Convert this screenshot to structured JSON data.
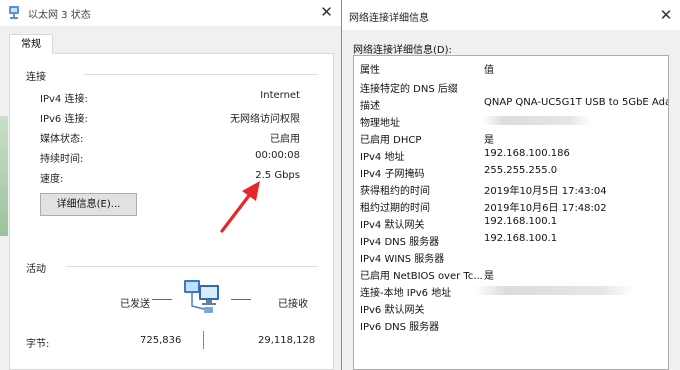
{
  "status_window": {
    "title": "以太网 3 状态",
    "close": "✕",
    "tab_general": "常规",
    "connection_group": "连接",
    "rows": [
      {
        "label": "IPv4 连接:",
        "value": "Internet"
      },
      {
        "label": "IPv6 连接:",
        "value": "无网络访问权限"
      },
      {
        "label": "媒体状态:",
        "value": "已启用"
      },
      {
        "label": "持续时间:",
        "value": "00:00:08"
      },
      {
        "label": "速度:",
        "value": "2.5 Gbps"
      }
    ],
    "details_button": "详细信息(E)...",
    "activity_group": "活动",
    "sent_label": "已发送",
    "received_label": "已接收",
    "bytes_label": "字节:",
    "bytes_sent": "725,836",
    "bytes_received": "29,118,128",
    "annotation_color": "#e8262a"
  },
  "details_window": {
    "title": "网络连接详细信息",
    "close": "✕",
    "caption": "网络连接详细信息(D):",
    "col_property": "属性",
    "col_value": "值",
    "rows": [
      {
        "prop": "连接特定的 DNS 后缀",
        "value": ""
      },
      {
        "prop": "描述",
        "value": "QNAP QNA-UC5G1T USB to 5GbE Adap"
      },
      {
        "prop": "物理地址",
        "value": ""
      },
      {
        "prop": "已启用 DHCP",
        "value": "是"
      },
      {
        "prop": "IPv4 地址",
        "value": "192.168.100.186"
      },
      {
        "prop": "IPv4 子网掩码",
        "value": "255.255.255.0"
      },
      {
        "prop": "获得租约的时间",
        "value": "2019年10月5日 17:43:04"
      },
      {
        "prop": "租约过期的时间",
        "value": "2019年10月6日 17:48:02"
      },
      {
        "prop": "IPv4 默认网关",
        "value": "192.168.100.1"
      },
      {
        "prop": "IPv4 DNS 服务器",
        "value": "192.168.100.1"
      },
      {
        "prop": "IPv4 WINS 服务器",
        "value": ""
      },
      {
        "prop": "已启用 NetBIOS over Tc...",
        "value": "是"
      },
      {
        "prop": "连接-本地 IPv6 地址",
        "value": ""
      },
      {
        "prop": "IPv6 默认网关",
        "value": ""
      },
      {
        "prop": "IPv6 DNS 服务器",
        "value": ""
      }
    ]
  }
}
